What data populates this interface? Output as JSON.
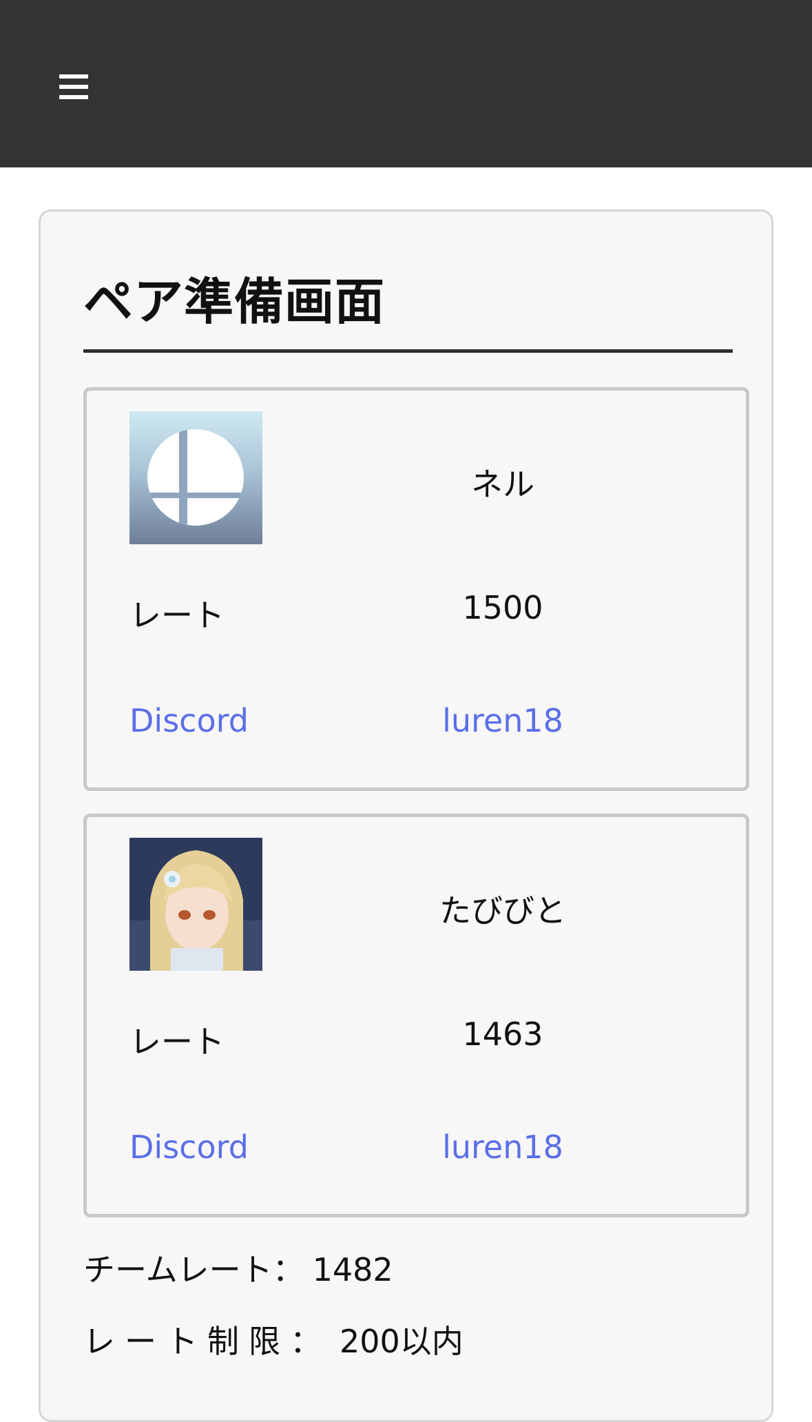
{
  "header": {
    "menu_icon": "hamburger-menu-icon"
  },
  "page": {
    "title": "ペア準備画面"
  },
  "players": [
    {
      "avatar": "smash-bros-logo-icon",
      "name": "ネル",
      "rate_label": "レート",
      "rate_value": "1500",
      "discord_label": "Discord",
      "discord_id": "luren18"
    },
    {
      "avatar": "anime-character-portrait",
      "name": "たびびと",
      "rate_label": "レート",
      "rate_value": "1463",
      "discord_label": "Discord",
      "discord_id": "luren18"
    }
  ],
  "summary": {
    "team_rate_label": "チームレート：",
    "team_rate_value": "1482",
    "rate_limit_label": "レート制限：",
    "rate_limit_value": "200以内"
  },
  "colors": {
    "topbar": "#333333",
    "link": "#5b6ee8",
    "panel_bg": "#f7f7f7",
    "card_border": "#c8c8c8"
  }
}
